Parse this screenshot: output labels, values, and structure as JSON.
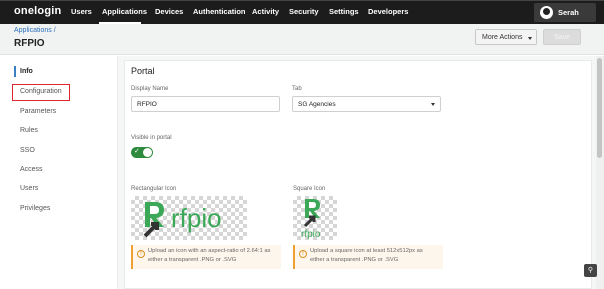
{
  "nav": {
    "brand": "onelogin",
    "items": [
      "Users",
      "Applications",
      "Devices",
      "Authentication",
      "Activity",
      "Security",
      "Settings",
      "Developers"
    ],
    "active": "Applications",
    "user": "Serah"
  },
  "header": {
    "breadcrumb": "Applications /",
    "title": "RFPIO",
    "more_actions": "More Actions",
    "save": "Save"
  },
  "sidebar": {
    "items": [
      "Info",
      "Configuration",
      "Parameters",
      "Rules",
      "SSO",
      "Access",
      "Users",
      "Privileges"
    ],
    "active": "Info",
    "highlighted": "Configuration"
  },
  "portal": {
    "title": "Portal",
    "display_name_label": "Display Name",
    "display_name_value": "RFPIO",
    "tab_label": "Tab",
    "tab_value": "SG Agencies",
    "visible_label": "Visible in portal",
    "visible": true,
    "rect_icon_label": "Rectangular Icon",
    "rect_icon_text": "rfpio",
    "rect_icon_info_1": "Upload an icon with an aspect-ratio of 2.64:1 as",
    "rect_icon_info_2": "either a transparent .PNG or .SVG",
    "square_icon_label": "Square Icon",
    "square_icon_text": "rfpio",
    "square_icon_info_1": "Upload a square icon at least 512x512px as",
    "square_icon_info_2": "either a transparent .PNG or .SVG"
  },
  "colors": {
    "nav_bg": "#1c1c1c",
    "accent_blue": "#2c72bd",
    "toggle_green": "#2e8b3e",
    "highlight_red": "#e0252e",
    "logo_green": "#3aa856",
    "warn_orange": "#f0a030"
  },
  "icons": [
    "user-avatar-icon",
    "chevron-down-icon",
    "checkmark-icon",
    "info-icon",
    "pin-icon"
  ]
}
